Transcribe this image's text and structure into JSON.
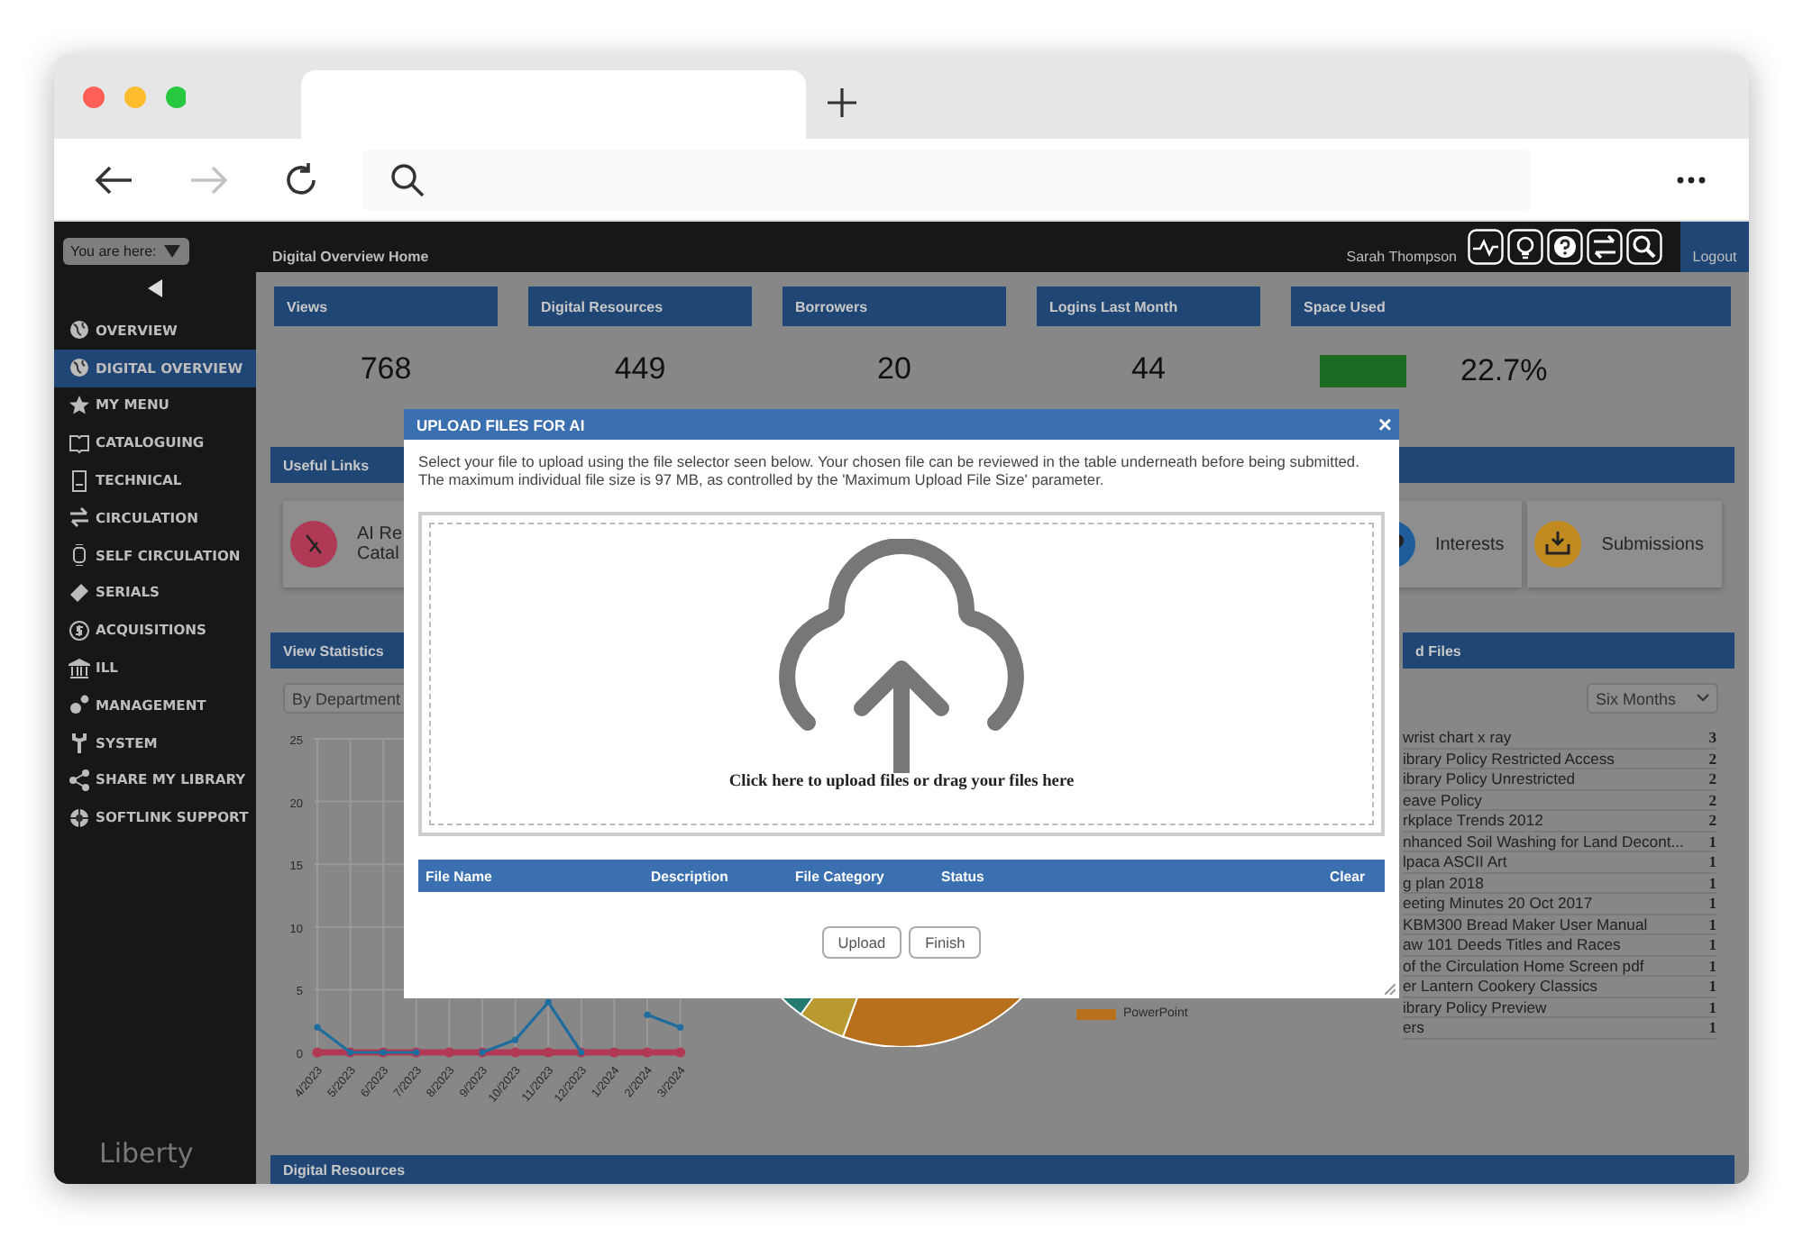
{
  "browser": {
    "forward_disabled": true
  },
  "sidebar": {
    "location_label": "You are here:",
    "items": [
      {
        "label": "OVERVIEW",
        "selected": false
      },
      {
        "label": "DIGITAL OVERVIEW",
        "selected": true
      },
      {
        "label": "MY MENU",
        "selected": false
      },
      {
        "label": "CATALOGUING",
        "selected": false
      },
      {
        "label": "TECHNICAL",
        "selected": false
      },
      {
        "label": "CIRCULATION",
        "selected": false
      },
      {
        "label": "SELF CIRCULATION",
        "selected": false
      },
      {
        "label": "SERIALS",
        "selected": false
      },
      {
        "label": "ACQUISITIONS",
        "selected": false
      },
      {
        "label": "ILL",
        "selected": false
      },
      {
        "label": "MANAGEMENT",
        "selected": false
      },
      {
        "label": "SYSTEM",
        "selected": false
      },
      {
        "label": "SHARE MY LIBRARY",
        "selected": false
      },
      {
        "label": "SOFTLINK SUPPORT",
        "selected": false
      }
    ],
    "logo": "Liberty"
  },
  "topbar": {
    "title": "Digital Overview Home",
    "user": "Sarah Thompson",
    "logout": "Logout"
  },
  "stats": [
    {
      "kind": "count",
      "label": "Views",
      "value": "768"
    },
    {
      "kind": "count",
      "label": "Digital Resources",
      "value": "449"
    },
    {
      "kind": "count",
      "label": "Borrowers",
      "value": "20"
    },
    {
      "kind": "count",
      "label": "Logins Last Month",
      "value": "44"
    },
    {
      "kind": "usage",
      "label": "Space Used",
      "value": "22.7%"
    }
  ],
  "useful_links": {
    "title": "Useful Links",
    "links": [
      {
        "lines": [
          "AI Re",
          "Catal"
        ],
        "color": "#b03a55"
      },
      {
        "lines": [
          "Interests"
        ],
        "color": "#1f5c9a"
      },
      {
        "lines": [
          "Submissions"
        ],
        "color": "#c08a20"
      }
    ]
  },
  "view_statistics": {
    "title": "View Statistics",
    "filter": "By Department",
    "chart_data": {
      "type": "line",
      "categories": [
        "4/2023",
        "5/2023",
        "6/2023",
        "7/2023",
        "8/2023",
        "9/2023",
        "10/2023",
        "11/2023",
        "12/2023",
        "1/2024",
        "2/2024",
        "3/2024"
      ],
      "ylim": [
        0,
        25
      ],
      "yticks": [
        0,
        5,
        10,
        15,
        20,
        25
      ],
      "grid": true,
      "series": [
        {
          "color": "#1f6d9e",
          "marker": true,
          "values": [
            2,
            0,
            0,
            0,
            null,
            0,
            1,
            4,
            0,
            null,
            3,
            2
          ]
        },
        {
          "color": "#b03a55",
          "marker": true,
          "values": [
            0,
            0,
            0,
            0,
            0,
            0,
            0,
            0,
            0,
            0,
            0,
            0
          ]
        }
      ]
    }
  },
  "file_types": {
    "legend": [
      {
        "label": "PowerPoint",
        "color": "#b8701c"
      }
    ]
  },
  "top_files": {
    "title": "d Files",
    "period": "Six Months",
    "rows": [
      {
        "name": "wrist chart x ray",
        "count": "3"
      },
      {
        "name": "ibrary Policy Restricted Access",
        "count": "2"
      },
      {
        "name": "ibrary Policy Unrestricted",
        "count": "2"
      },
      {
        "name": "eave Policy",
        "count": "2"
      },
      {
        "name": "rkplace Trends 2012",
        "count": "2"
      },
      {
        "name": "nhanced Soil Washing for Land Decont...",
        "count": "1"
      },
      {
        "name": "lpaca ASCII Art",
        "count": "1"
      },
      {
        "name": "g plan 2018",
        "count": "1"
      },
      {
        "name": "eeting Minutes 20 Oct 2017",
        "count": "1"
      },
      {
        "name": "KBM300 Bread Maker User Manual",
        "count": "1"
      },
      {
        "name": "aw 101 Deeds Titles and Races",
        "count": "1"
      },
      {
        "name": "of the Circulation Home Screen pdf",
        "count": "1"
      },
      {
        "name": "er Lantern Cookery Classics",
        "count": "1"
      },
      {
        "name": "ibrary Policy Preview",
        "count": "1"
      },
      {
        "name": "ers",
        "count": "1"
      }
    ]
  },
  "digital_resources": {
    "title": "Digital Resources"
  },
  "modal": {
    "title": "UPLOAD FILES FOR AI",
    "close": "×",
    "intro": "Select your file to upload using the file selector seen below. Your chosen file can be reviewed in the table underneath before being submitted.",
    "limit": "The maximum individual file size is 97 MB, as controlled by the 'Maximum Upload File Size' parameter.",
    "dropzone": "Click here to upload files or drag your files here",
    "columns": [
      "File Name",
      "Description",
      "File Category",
      "Status",
      "Clear"
    ],
    "buttons": [
      "Upload",
      "Finish"
    ]
  }
}
